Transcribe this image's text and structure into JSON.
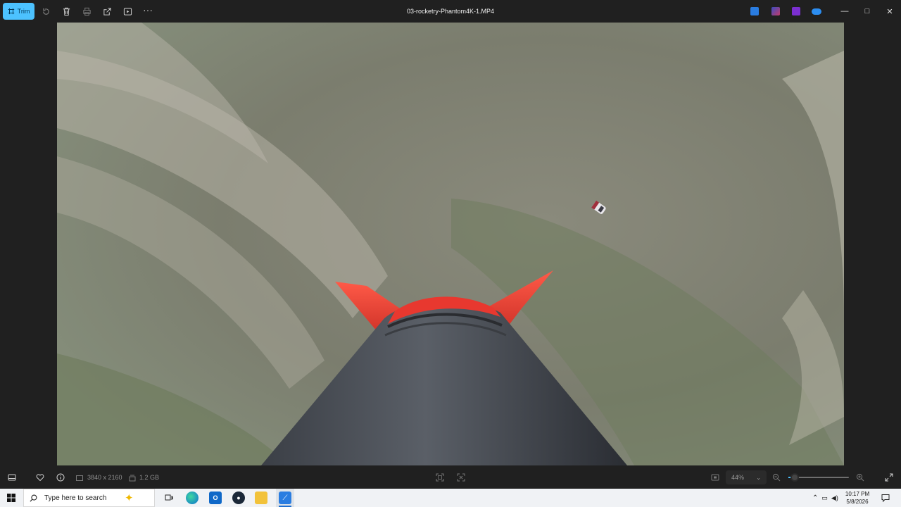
{
  "toolbar": {
    "trim_label": "Trim",
    "title": "03-rocketry-Phantom4K-1.MP4",
    "icons": [
      "trim-icon",
      "rotate-icon",
      "delete-icon",
      "print-icon",
      "share-icon",
      "slideshow-icon",
      "more-icon"
    ],
    "more_label": "···"
  },
  "window_controls": {
    "minimize": "—",
    "maximize": "□",
    "close": "✕"
  },
  "bottom": {
    "resolution": "3840 x 2160",
    "file_size": "1.2 GB",
    "zoom_value": "44%",
    "zoom_fraction": 0.1
  },
  "taskbar": {
    "search_placeholder": "Type here to search",
    "time": "10:17 PM",
    "date": "5/8/2026"
  },
  "colors": {
    "accent": "#4cc2ff",
    "fin_red": "#e8382f",
    "ground": "#7f8074"
  }
}
